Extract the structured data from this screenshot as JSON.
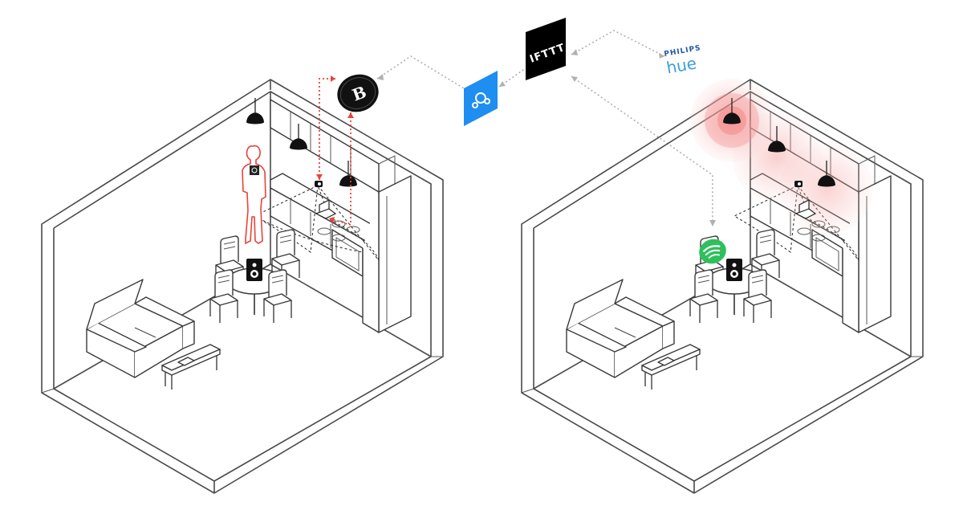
{
  "services": {
    "ifttt": {
      "label": "IFTTT",
      "color": "#000000",
      "icon": "ifttt-logo"
    },
    "webhooks": {
      "color": "#1e8ef0",
      "icon": "webhooks-logo"
    },
    "bridge_b": {
      "label": "B",
      "color": "#111111",
      "icon": "b-camera-service-logo"
    },
    "philips_hue": {
      "brand": "PHILIPS",
      "product": "hue",
      "icon": "philips-hue-logo"
    },
    "spotify": {
      "color": "#2ec05c",
      "icon": "spotify-logo"
    }
  },
  "scenes": {
    "left": {
      "name": "kitchen-camera-detection",
      "highlight_color": "#e8433a"
    },
    "right": {
      "name": "lights-and-music-response",
      "light_glow_color": "#f6a3a3"
    }
  },
  "connectors": {
    "grey_color": "#b0b0b0",
    "red_color": "#e8433a"
  }
}
